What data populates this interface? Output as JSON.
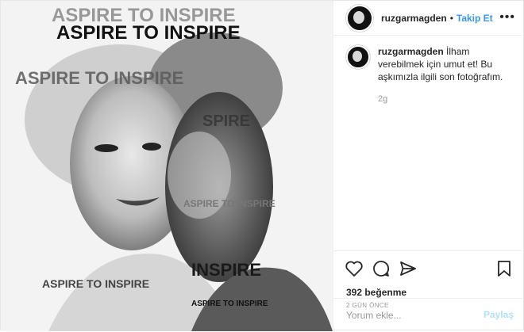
{
  "post": {
    "username": "ruzgarmagden",
    "follow_label": "Takip Et",
    "separator": "•",
    "more_label": "•••"
  },
  "caption": {
    "username": "ruzgarmagden",
    "text": "İlham verebilmek için umut et! Bu aşkımızla ilgili son fotoğrafım.",
    "age": "2g"
  },
  "photo": {
    "texts": [
      "ASPIRE TO INSPIRE",
      "ASPIRE TO INSPIRE",
      "ASPIRE TO INSPIRE",
      "SPIRE",
      "ASPIRE TO INSPIRE",
      "INSPIRE",
      "ASPIRE TO INSPIRE",
      "ASPIRE TO INSPIRE"
    ]
  },
  "stats": {
    "likes": "392 beğenme",
    "posted": "2 GÜN ÖNCE"
  },
  "comment": {
    "placeholder": "Yorum ekle...",
    "share_label": "Paylaş"
  },
  "icons": [
    "heart-icon",
    "comment-icon",
    "share-icon",
    "bookmark-icon"
  ]
}
